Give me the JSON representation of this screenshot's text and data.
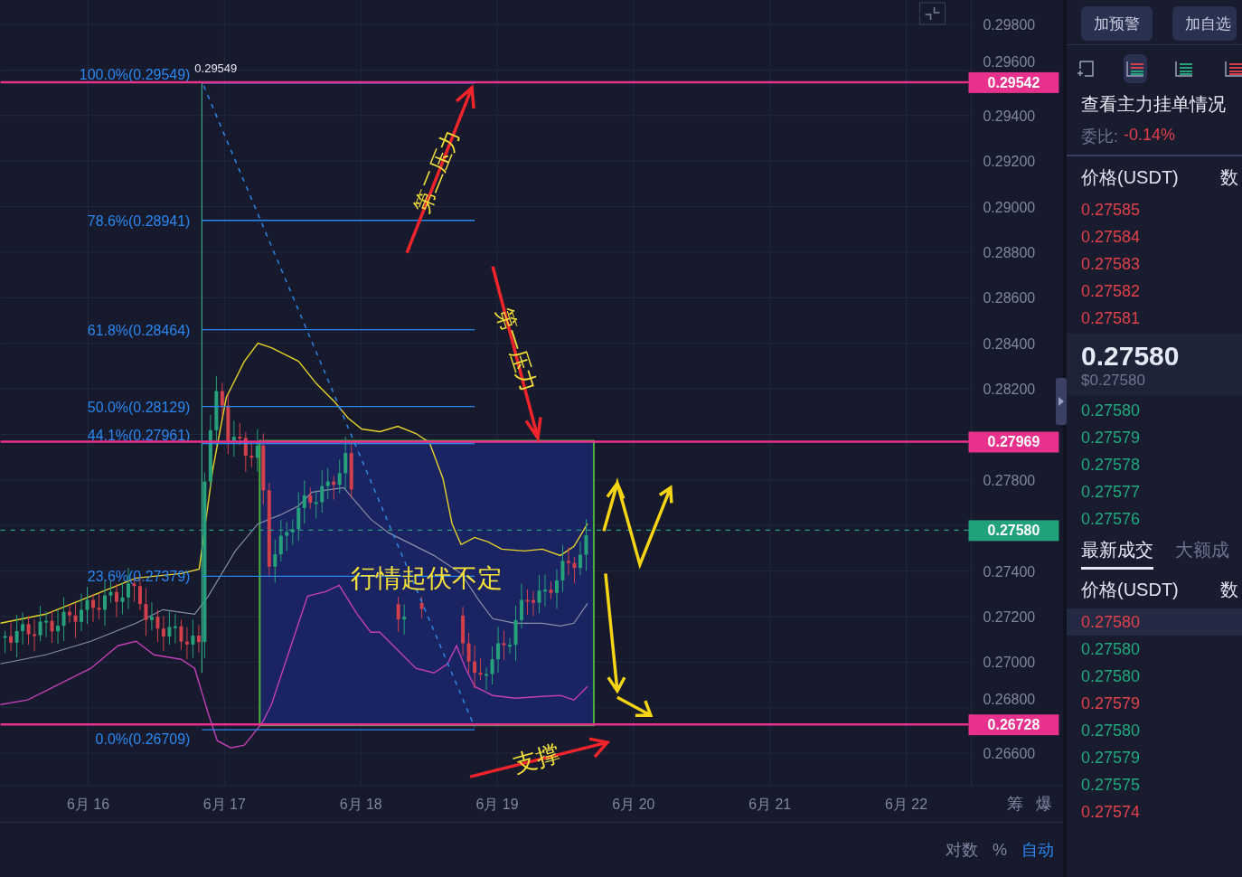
{
  "chart": {
    "y_axis": [
      "0.29800",
      "0.29600",
      "0.29400",
      "0.29200",
      "0.29000",
      "0.28800",
      "0.28600",
      "0.28400",
      "0.28200",
      "0.27800",
      "0.27400",
      "0.27200",
      "0.27000",
      "0.26800",
      "0.26600"
    ],
    "price_tags": [
      {
        "text": "0.29542",
        "kind": "line"
      },
      {
        "text": "0.27969",
        "kind": "line"
      },
      {
        "text": "0.27580",
        "kind": "current"
      },
      {
        "text": "0.26728",
        "kind": "line"
      }
    ],
    "fib_levels": [
      {
        "label": "100.0%(0.29549)"
      },
      {
        "label": "78.6%(0.28941)"
      },
      {
        "label": "61.8%(0.28464)"
      },
      {
        "label": "50.0%(0.28129)"
      },
      {
        "label": "44.1%(0.27961)"
      },
      {
        "label": "23.6%(0.27379)"
      },
      {
        "label": "0.0%(0.26709)"
      }
    ],
    "fib_top_price": "0.29549",
    "annotations": [
      {
        "text": "第二压力"
      },
      {
        "text": "第一压力"
      },
      {
        "text": "行情起伏不定"
      },
      {
        "text": "支撑"
      }
    ],
    "x_axis": [
      "6月 16",
      "6月 17",
      "6月 18",
      "6月 19",
      "6月 20",
      "6月 21",
      "6月 22"
    ],
    "axis_buttons": [
      "筹",
      "爆"
    ],
    "scale_options": [
      {
        "label": "对数",
        "selected": false
      },
      {
        "label": "%",
        "selected": false
      },
      {
        "label": "自动",
        "selected": true
      }
    ]
  },
  "panel": {
    "buttons": [
      "加预警",
      "加自选"
    ],
    "view_icons": [
      {
        "kind": "add-window",
        "selected": false
      },
      {
        "kind": "buy-sell",
        "selected": true
      },
      {
        "kind": "buy",
        "selected": false
      },
      {
        "kind": "sell",
        "selected": false
      }
    ],
    "title": "查看主力挂单情况",
    "ratio_label": "委比:",
    "ratio_value": "-0.14%",
    "book_columns": [
      "价格(USDT)",
      "数"
    ],
    "asks": [
      {
        "price": "0.27585"
      },
      {
        "price": "0.27584"
      },
      {
        "price": "0.27583"
      },
      {
        "price": "0.27582"
      },
      {
        "price": "0.27581"
      }
    ],
    "last_price": "0.27580",
    "last_price_usd": "$0.27580",
    "bids": [
      {
        "price": "0.27580"
      },
      {
        "price": "0.27579"
      },
      {
        "price": "0.27578"
      },
      {
        "price": "0.27577"
      },
      {
        "price": "0.27576"
      }
    ],
    "trade_tabs": [
      {
        "label": "最新成交",
        "selected": true
      },
      {
        "label": "大额成",
        "selected": false
      }
    ],
    "trade_columns": [
      "价格(USDT)",
      "数"
    ],
    "trades": [
      {
        "price": "0.27580",
        "color": "#e0404a",
        "highlighted": true
      },
      {
        "price": "0.27580",
        "color": "#22a87c",
        "highlighted": false
      },
      {
        "price": "0.27580",
        "color": "#22a87c",
        "highlighted": false
      },
      {
        "price": "0.27579",
        "color": "#e0404a",
        "highlighted": false
      },
      {
        "price": "0.27580",
        "color": "#22a87c",
        "highlighted": false
      },
      {
        "price": "0.27579",
        "color": "#22a87c",
        "highlighted": false
      },
      {
        "price": "0.27575",
        "color": "#22a87c",
        "highlighted": false
      },
      {
        "price": "0.27574",
        "color": "#e0404a",
        "highlighted": false
      }
    ]
  }
}
